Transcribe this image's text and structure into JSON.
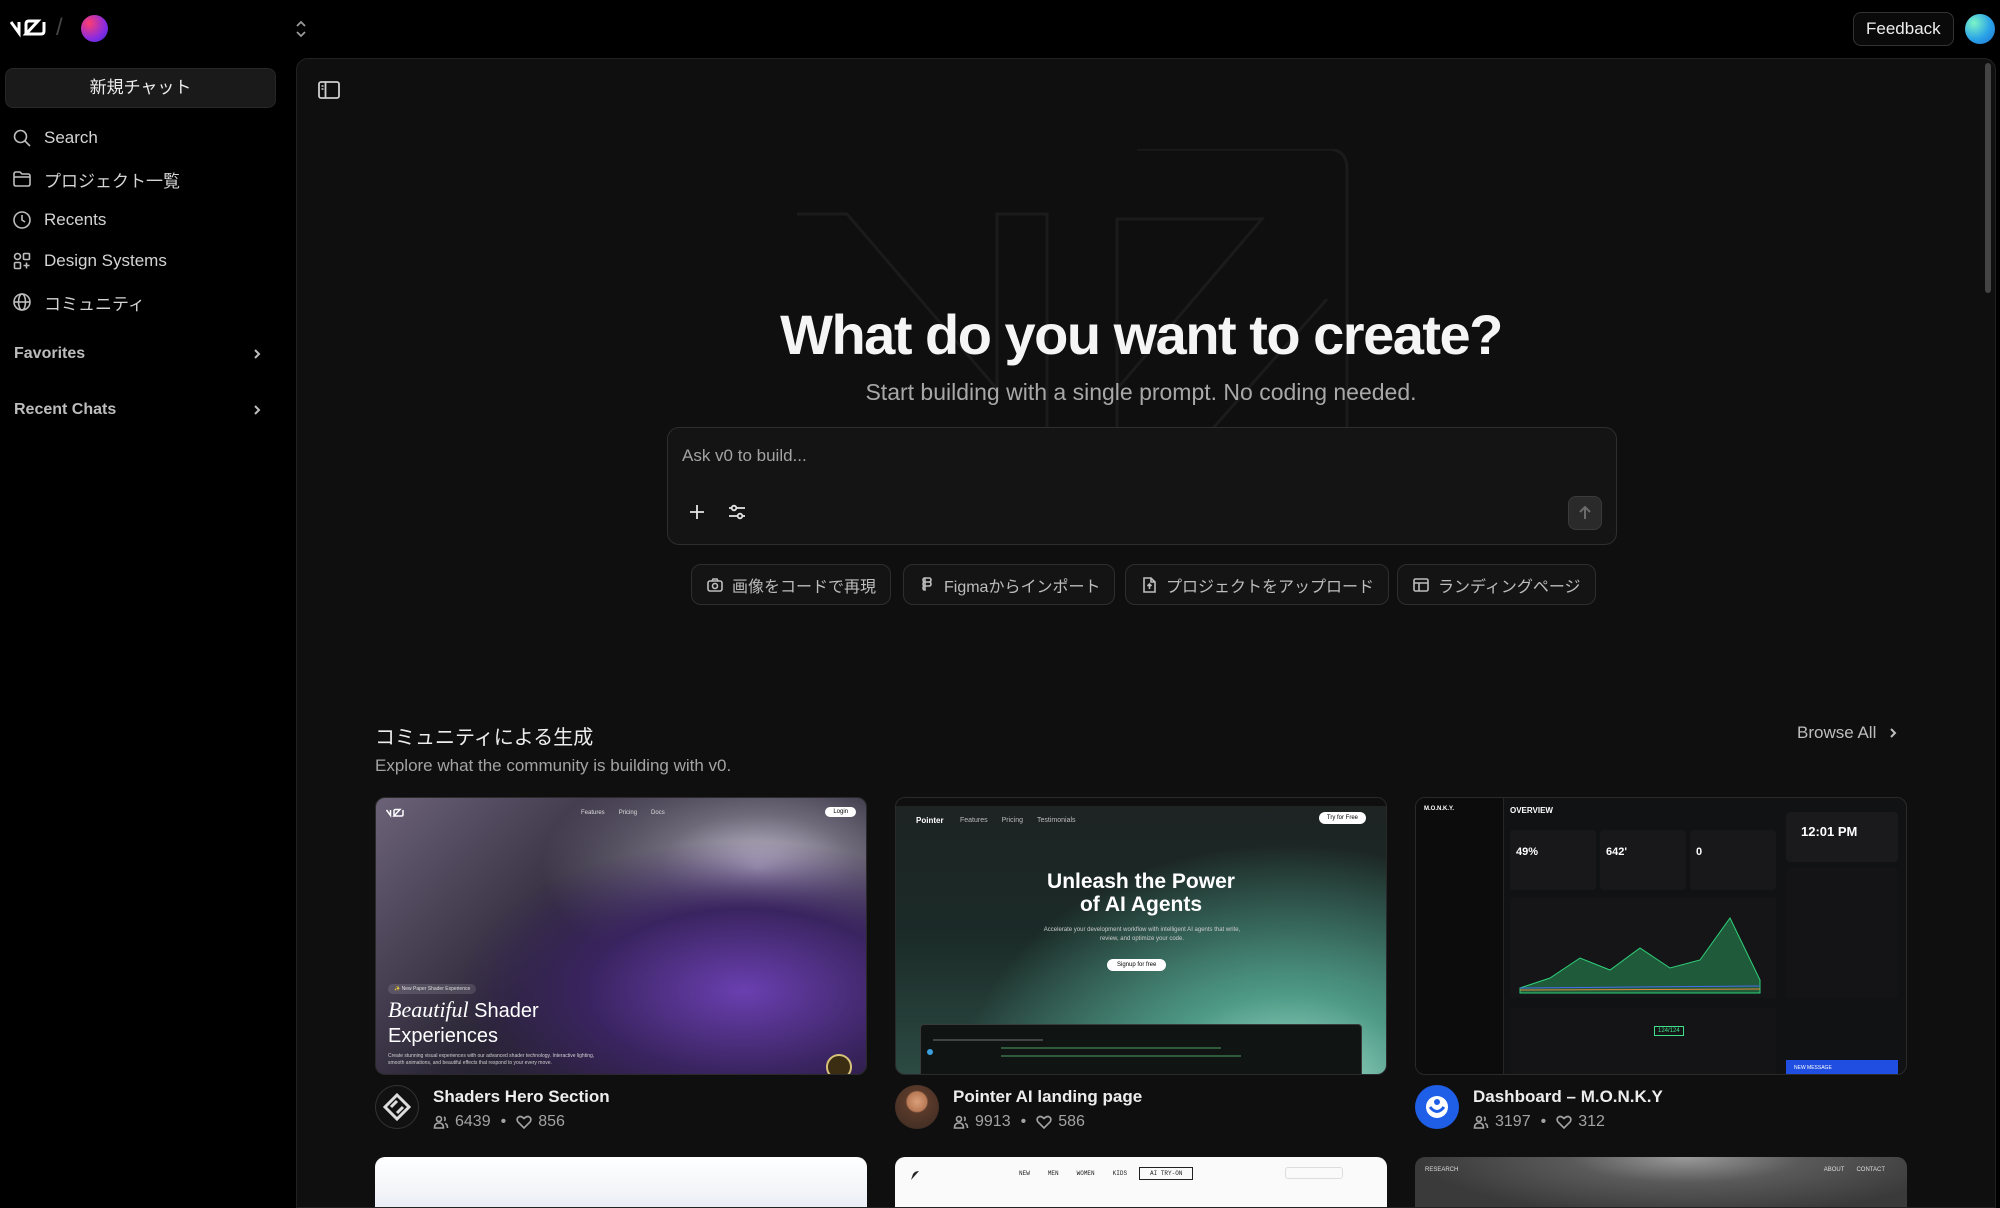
{
  "topbar": {
    "logo_text": "v0",
    "separator": "/",
    "feedback_label": "Feedback"
  },
  "sidebar": {
    "new_chat_label": "新規チャット",
    "items": [
      {
        "label": "Search",
        "icon": "search-icon"
      },
      {
        "label": "プロジェクト一覧",
        "icon": "folder-icon"
      },
      {
        "label": "Recents",
        "icon": "clock-icon"
      },
      {
        "label": "Design Systems",
        "icon": "grid-icon"
      },
      {
        "label": "コミュニティ",
        "icon": "globe-icon"
      }
    ],
    "favorites_label": "Favorites",
    "recent_chats_label": "Recent Chats"
  },
  "hero": {
    "title": "What do you want to create?",
    "subtitle": "Start building with a single prompt. No coding needed."
  },
  "prompt": {
    "placeholder": "Ask v0 to build..."
  },
  "chips": [
    {
      "label": "画像をコードで再現",
      "icon": "camera-icon"
    },
    {
      "label": "Figmaからインポート",
      "icon": "figma-icon"
    },
    {
      "label": "プロジェクトをアップロード",
      "icon": "file-upload-icon"
    },
    {
      "label": "ランディングページ",
      "icon": "layout-icon"
    }
  ],
  "community": {
    "title": "コミュニティによる生成",
    "subtitle": "Explore what the community is building with v0.",
    "browse_all": "Browse All",
    "cards": [
      {
        "title": "Shaders Hero Section",
        "views": "6439",
        "likes": "856",
        "thumb": {
          "nav": [
            "Features",
            "Pricing",
            "Docs"
          ],
          "login": "Login",
          "badge": "✨ New Paper Shader Experience",
          "headline_em": "Beautiful",
          "headline_rest": "Shader",
          "headline_line2": "Experiences",
          "body": "Create stunning visual experiences with our advanced shader technology. Interactive lighting, smooth animations, and beautiful effects that respond to your every move."
        }
      },
      {
        "title": "Pointer AI landing page",
        "views": "9913",
        "likes": "586",
        "thumb": {
          "brand": "Pointer",
          "nav": [
            "Features",
            "Pricing",
            "Testimonials"
          ],
          "cta": "Try for Free",
          "headline_line1": "Unleash the Power",
          "headline_line2": "of AI Agents",
          "body": "Accelerate your development workflow with intelligent AI agents that write, review, and optimize your code.",
          "signup": "Signup for free"
        }
      },
      {
        "title": "Dashboard – M.O.N.K.Y",
        "views": "3197",
        "likes": "312",
        "thumb": {
          "brand": "M.O.N.K.Y.",
          "section": "OVERVIEW",
          "time": "12:01 PM",
          "stat1": "49%",
          "stat2": "642'",
          "stat3": "0",
          "badge": "124/124",
          "new_message": "NEW MESSAGE"
        }
      }
    ],
    "row2_thumbs": [
      {
        "nav": [
          "NEW",
          "MEN",
          "WOMEN",
          "KIDS"
        ],
        "input": "AI TRY-ON"
      },
      {
        "brand": "RESEARCH",
        "nav": [
          "ABOUT",
          "CONTACT"
        ]
      }
    ]
  },
  "colors": {
    "background": "#000000",
    "panel": "#0f0f0f",
    "border": "#2e2e2e",
    "text": "#ededed",
    "muted": "#a3a3a3"
  }
}
